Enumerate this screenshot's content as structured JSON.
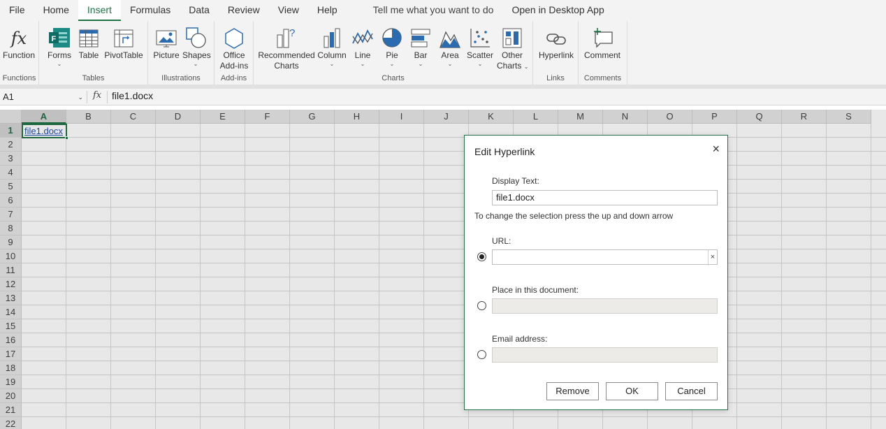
{
  "menu": {
    "items": [
      "File",
      "Home",
      "Insert",
      "Formulas",
      "Data",
      "Review",
      "View",
      "Help"
    ],
    "active": "Insert",
    "tell_me": "Tell me what you want to do",
    "open_desktop": "Open in Desktop App"
  },
  "ribbon": {
    "functions": {
      "function_label": "Function",
      "group_label": "Functions"
    },
    "tables": {
      "forms_label": "Forms",
      "table_label": "Table",
      "pivot_label": "PivotTable",
      "group_label": "Tables"
    },
    "illustrations": {
      "picture_label": "Picture",
      "shapes_label": "Shapes",
      "group_label": "Illustrations"
    },
    "addins": {
      "office_label_1": "Office",
      "office_label_2": "Add-ins",
      "group_label": "Add-ins"
    },
    "charts": {
      "recommended_1": "Recommended",
      "recommended_2": "Charts",
      "column_label": "Column",
      "line_label": "Line",
      "pie_label": "Pie",
      "bar_label": "Bar",
      "area_label": "Area",
      "scatter_label": "Scatter",
      "other_1": "Other",
      "other_2": "Charts",
      "group_label": "Charts"
    },
    "links": {
      "hyperlink_label": "Hyperlink",
      "group_label": "Links"
    },
    "comments": {
      "comment_label": "Comment",
      "group_label": "Comments"
    }
  },
  "formula_bar": {
    "name_box": "A1",
    "fx": "fx",
    "value": "file1.docx"
  },
  "grid": {
    "columns": [
      "A",
      "B",
      "C",
      "D",
      "E",
      "F",
      "G",
      "H",
      "I",
      "J",
      "K",
      "L",
      "M",
      "N",
      "O",
      "P",
      "Q",
      "R",
      "S"
    ],
    "rows": [
      "1",
      "2",
      "3",
      "4",
      "5",
      "6",
      "7",
      "8",
      "9",
      "10",
      "11",
      "12",
      "13",
      "14",
      "15",
      "16",
      "17",
      "18",
      "19",
      "20",
      "21",
      "22"
    ],
    "a1_value": "file1.docx"
  },
  "dialog": {
    "title": "Edit Hyperlink",
    "close": "×",
    "display_text_label": "Display Text:",
    "display_text_value": "file1.docx",
    "hint": "To change the selection press the up and down arrow",
    "url_label": "URL:",
    "url_value": "",
    "url_clear": "×",
    "place_label": "Place in this document:",
    "email_label": "Email address:",
    "remove_label": "Remove",
    "ok_label": "OK",
    "cancel_label": "Cancel"
  },
  "colors": {
    "accent": "#217346",
    "link": "#1f4fb3",
    "icon_blue": "#2b6cb0"
  }
}
